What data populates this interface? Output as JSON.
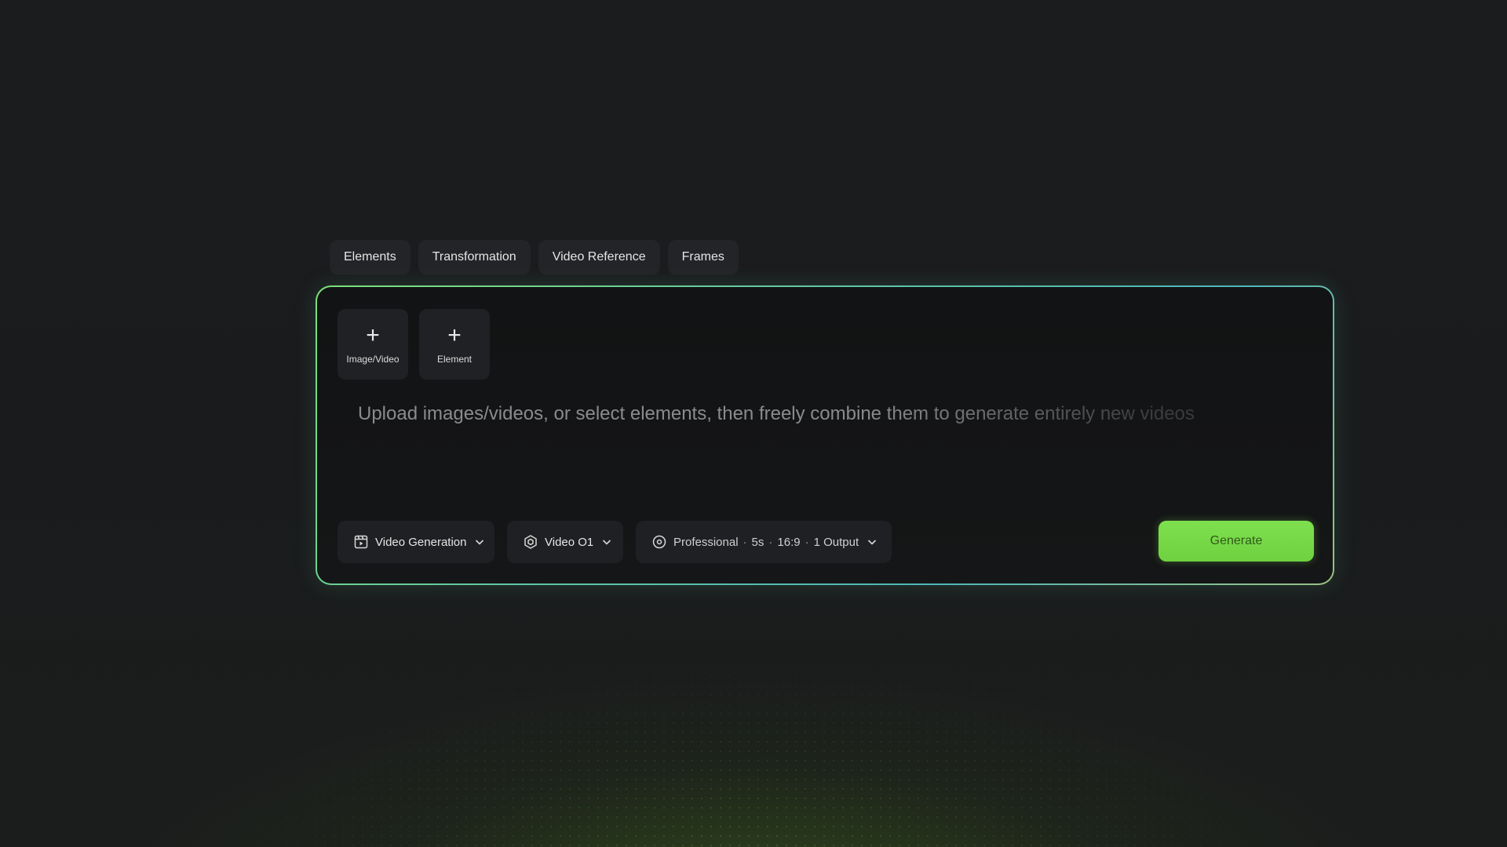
{
  "tabs": [
    {
      "label": "Elements"
    },
    {
      "label": "Transformation"
    },
    {
      "label": "Video Reference"
    },
    {
      "label": "Frames"
    }
  ],
  "upload": {
    "image_video_label": "Image/Video",
    "element_label": "Element",
    "icon": "plus-icon"
  },
  "prompt": {
    "placeholder": "Upload images/videos, or select elements, then freely combine them to generate entirely new videos"
  },
  "controls": {
    "mode_label": "Video Generation",
    "mode_icon": "video-generation-icon",
    "model_label": "Video O1",
    "model_icon": "hexagon-model-icon",
    "settings": {
      "quality": "Professional",
      "duration": "5s",
      "ratio": "16:9",
      "outputs": "1 Output",
      "separator": "·",
      "icon": "settings-dial-icon"
    }
  },
  "generate": {
    "label": "Generate"
  },
  "colors": {
    "accent_green": "#6fd13f",
    "border_gradient_start": "#7ee07a",
    "border_gradient_end": "#4fb6b9",
    "background": "#1a1b1d"
  }
}
